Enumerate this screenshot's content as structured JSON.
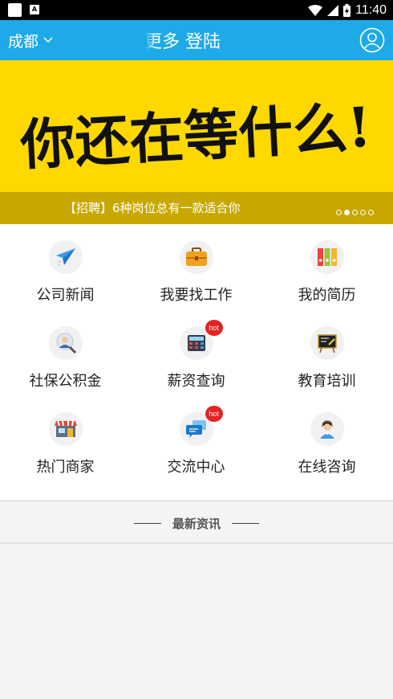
{
  "status_bar": {
    "time": "11:40",
    "notification_badge": "A"
  },
  "header": {
    "city": "成都",
    "tabs_visible_text": "更多   登陆",
    "accent_color": "#1eaae8"
  },
  "banner": {
    "slogan": "你还在等什么!",
    "caption": "【招聘】6种岗位总有一款适合你",
    "dot_count": 5,
    "active_dot": 1,
    "background_color": "#ffd800"
  },
  "grid": {
    "items": [
      {
        "label": "公司新闻",
        "icon": "paper-plane-icon",
        "hot": false
      },
      {
        "label": "我要找工作",
        "icon": "briefcase-icon",
        "hot": false
      },
      {
        "label": "我的简历",
        "icon": "binders-icon",
        "hot": false
      },
      {
        "label": "社保公积金",
        "icon": "person-badge-icon",
        "hot": false
      },
      {
        "label": "薪资查询",
        "icon": "calculator-icon",
        "hot": true
      },
      {
        "label": "教育培训",
        "icon": "blackboard-icon",
        "hot": false
      },
      {
        "label": "热门商家",
        "icon": "storefront-icon",
        "hot": false
      },
      {
        "label": "交流中心",
        "icon": "chat-bubbles-icon",
        "hot": true
      },
      {
        "label": "在线咨询",
        "icon": "support-agent-icon",
        "hot": false
      }
    ],
    "hot_badge": "hot"
  },
  "news": {
    "title": "最新资讯"
  }
}
